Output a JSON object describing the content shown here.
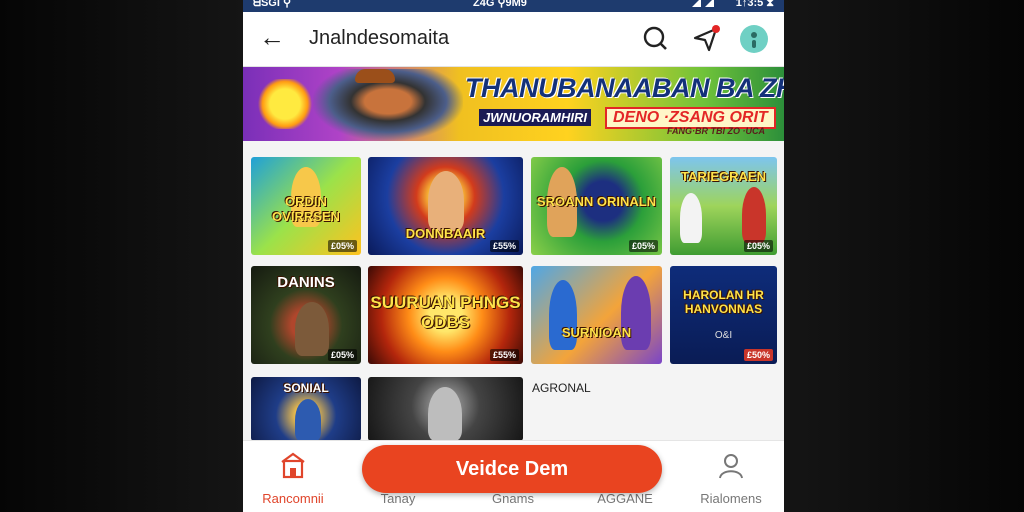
{
  "status_bar": {
    "left": "ᗺSGI ⚲",
    "center": "Z4G ⚲9M9",
    "right": "1↑3:5 ⧗"
  },
  "app_bar": {
    "title": "Jnalndesomaita"
  },
  "banner": {
    "headline": "THANUBANAABAN BA ZHAD",
    "subline_left": "JWNUORAMHIRI",
    "subline_right": "DENO ·ZSANG ORIT",
    "footer": "FANG·BR TBI ZO ·UCA"
  },
  "tiles": [
    {
      "title": "ORDIN OVIRRSEN",
      "badge": "£05%"
    },
    {
      "title": "DONNBAAIR",
      "badge": "£55%"
    },
    {
      "title": "SROANN ORINALN",
      "badge": "£05%"
    },
    {
      "title": "TARIEGRAEN",
      "badge": "£05%"
    },
    {
      "title": "DANINS",
      "badge": "£05%"
    },
    {
      "title": "SUURUAN PHNGS ODBS",
      "badge": "£55%"
    },
    {
      "title": "SURNIOAN",
      "badge": ""
    },
    {
      "title": "HAROLAN HR HANVONNAS",
      "badge": "£50%"
    },
    {
      "title": "SONIAL",
      "badge": ""
    },
    {
      "title": "",
      "badge": ""
    }
  ],
  "tile8_small": "O&I",
  "more_label": "AGRONAL",
  "bottom_nav": [
    {
      "label": "Rancomnii",
      "icon": "home-icon",
      "active": true
    },
    {
      "label": "Tanay",
      "icon": "grid-icon",
      "active": false
    },
    {
      "label": "Gnams",
      "icon": "games-icon",
      "active": false
    },
    {
      "label": "AGGANE",
      "icon": "trophy-icon",
      "active": false
    },
    {
      "label": "Rialomens",
      "icon": "person-icon",
      "active": false
    }
  ],
  "fab_label": "Veidce Dem",
  "colors": {
    "accent": "#e94420",
    "status_bar": "#1e3b6e"
  }
}
